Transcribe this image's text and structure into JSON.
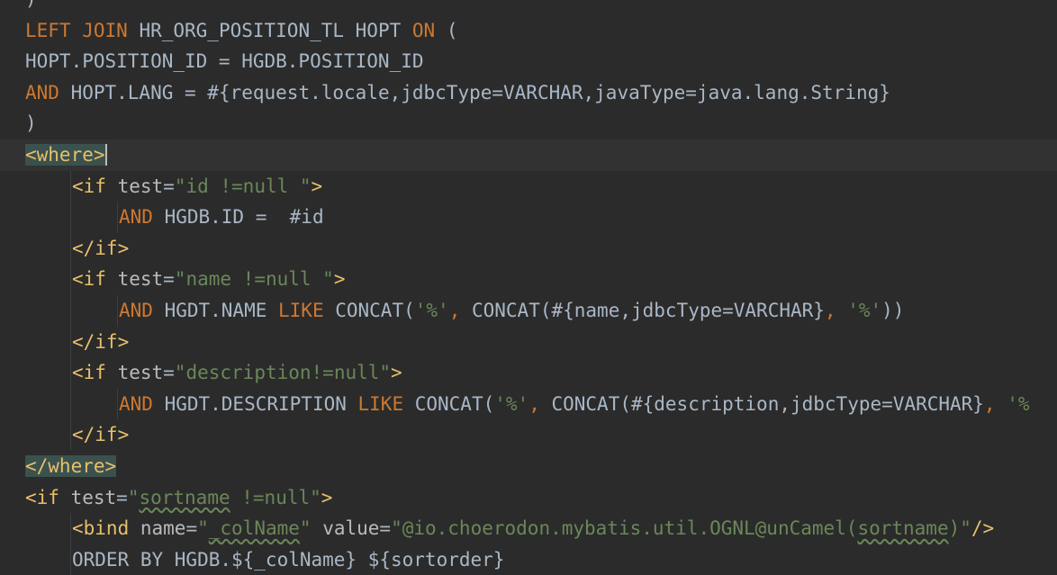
{
  "editor": {
    "language": "xml-sql",
    "colors": {
      "background": "#2b2b2b",
      "keyword": "#cc7832",
      "tag": "#e8bf6a",
      "string": "#6a8759",
      "text": "#a9b7c6",
      "tag_match_highlight": "#3b514d"
    },
    "lines": [
      {
        "parts": [
          {
            "t": ")",
            "c": "tx"
          }
        ]
      },
      {
        "parts": [
          {
            "t": "LEFT JOIN ",
            "c": "kw"
          },
          {
            "t": "HR_ORG_POSITION_TL HOPT ",
            "c": "tx"
          },
          {
            "t": "ON ",
            "c": "kw"
          },
          {
            "t": "(",
            "c": "tx"
          }
        ]
      },
      {
        "parts": [
          {
            "t": "HOPT.POSITION_ID = HGDB.POSITION_ID",
            "c": "tx"
          }
        ]
      },
      {
        "parts": [
          {
            "t": "AND ",
            "c": "kw"
          },
          {
            "t": "HOPT.LANG = #{request.locale,jdbcType=VARCHAR,javaType=java.lang.String}",
            "c": "tx"
          }
        ]
      },
      {
        "parts": [
          {
            "t": ")",
            "c": "tx"
          }
        ]
      },
      {
        "current": true,
        "caret_after": true,
        "parts": [
          {
            "t": "<where>",
            "c": "tag hl"
          }
        ]
      },
      {
        "indent": 1,
        "parts": [
          {
            "t": "<if ",
            "c": "tag"
          },
          {
            "t": "test",
            "c": "attr"
          },
          {
            "t": "=",
            "c": "tx"
          },
          {
            "t": "\"id !=null \"",
            "c": "str"
          },
          {
            "t": ">",
            "c": "tag"
          }
        ]
      },
      {
        "indent": 2,
        "parts": [
          {
            "t": "AND ",
            "c": "kw"
          },
          {
            "t": "HGDB.ID =  #id",
            "c": "tx"
          }
        ]
      },
      {
        "indent": 1,
        "parts": [
          {
            "t": "</if>",
            "c": "tag"
          }
        ]
      },
      {
        "indent": 1,
        "parts": [
          {
            "t": "<if ",
            "c": "tag"
          },
          {
            "t": "test",
            "c": "attr"
          },
          {
            "t": "=",
            "c": "tx"
          },
          {
            "t": "\"name !=null \"",
            "c": "str"
          },
          {
            "t": ">",
            "c": "tag"
          }
        ]
      },
      {
        "indent": 2,
        "parts": [
          {
            "t": "AND ",
            "c": "kw"
          },
          {
            "t": "HGDT.NAME ",
            "c": "tx"
          },
          {
            "t": "LIKE ",
            "c": "kw"
          },
          {
            "t": "CONCAT(",
            "c": "tx"
          },
          {
            "t": "'%'",
            "c": "str"
          },
          {
            "t": ", ",
            "c": "kw"
          },
          {
            "t": "CONCAT(#{name,jdbcType=VARCHAR}",
            "c": "tx"
          },
          {
            "t": ", ",
            "c": "kw"
          },
          {
            "t": "'%'",
            "c": "str"
          },
          {
            "t": "))",
            "c": "tx"
          }
        ]
      },
      {
        "indent": 1,
        "parts": [
          {
            "t": "</if>",
            "c": "tag"
          }
        ]
      },
      {
        "indent": 1,
        "parts": [
          {
            "t": "<if ",
            "c": "tag"
          },
          {
            "t": "test",
            "c": "attr"
          },
          {
            "t": "=",
            "c": "tx"
          },
          {
            "t": "\"description!=null\"",
            "c": "str"
          },
          {
            "t": ">",
            "c": "tag"
          }
        ]
      },
      {
        "indent": 2,
        "parts": [
          {
            "t": "AND ",
            "c": "kw"
          },
          {
            "t": "HGDT.DESCRIPTION ",
            "c": "tx"
          },
          {
            "t": "LIKE ",
            "c": "kw"
          },
          {
            "t": "CONCAT(",
            "c": "tx"
          },
          {
            "t": "'%'",
            "c": "str"
          },
          {
            "t": ", ",
            "c": "kw"
          },
          {
            "t": "CONCAT(#{description,jdbcType=VARCHAR}",
            "c": "tx"
          },
          {
            "t": ", ",
            "c": "kw"
          },
          {
            "t": "'%",
            "c": "str"
          }
        ]
      },
      {
        "indent": 1,
        "parts": [
          {
            "t": "</if>",
            "c": "tag"
          }
        ]
      },
      {
        "parts": [
          {
            "t": "</where>",
            "c": "tag hl"
          }
        ]
      },
      {
        "parts": [
          {
            "t": "<if ",
            "c": "tag"
          },
          {
            "t": "test",
            "c": "attr"
          },
          {
            "t": "=",
            "c": "tx"
          },
          {
            "t": "\"",
            "c": "str"
          },
          {
            "t": "sortname",
            "c": "str wavy"
          },
          {
            "t": " !=null\"",
            "c": "str"
          },
          {
            "t": ">",
            "c": "tag"
          }
        ]
      },
      {
        "indent": 1,
        "parts": [
          {
            "t": "<bind ",
            "c": "tag"
          },
          {
            "t": "name",
            "c": "attr"
          },
          {
            "t": "=",
            "c": "tx"
          },
          {
            "t": "\"",
            "c": "str"
          },
          {
            "t": "_colName",
            "c": "str wavy"
          },
          {
            "t": "\" ",
            "c": "str"
          },
          {
            "t": "value",
            "c": "attr"
          },
          {
            "t": "=",
            "c": "tx"
          },
          {
            "t": "\"@io.choerodon.mybatis.util.OGNL@unCamel(",
            "c": "str"
          },
          {
            "t": "sortname",
            "c": "str wavy"
          },
          {
            "t": ")\"",
            "c": "str"
          },
          {
            "t": "/>",
            "c": "tag"
          }
        ]
      },
      {
        "indent": 1,
        "parts": [
          {
            "t": "ORDER BY HGDB.${_colName} ${sortorder}",
            "c": "tx"
          }
        ]
      }
    ]
  }
}
